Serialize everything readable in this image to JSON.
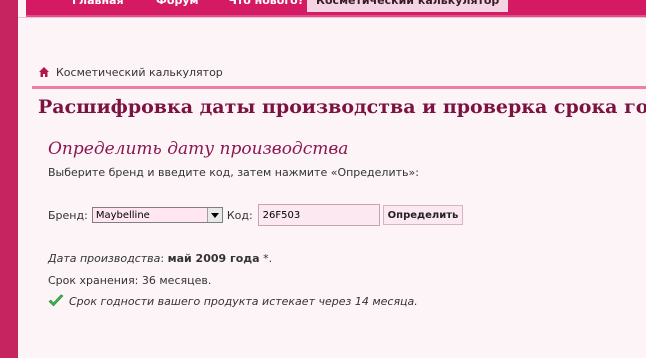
{
  "nav": {
    "items": [
      {
        "label": "Главная"
      },
      {
        "label": "Форум"
      },
      {
        "label": "Что нового?"
      },
      {
        "label": "Косметический калькулятор"
      }
    ]
  },
  "breadcrumb": {
    "label": "Косметический калькулятор"
  },
  "page_title": "Расшифровка даты производства и проверка срока годн",
  "section": {
    "title": "Определить дату производства",
    "instructions": "Выберите бренд и введите код, затем нажмите «Определить»:"
  },
  "form": {
    "brand_label": "Бренд:",
    "brand_value": "Maybelline",
    "code_label": "Код:",
    "code_value": "26F503",
    "submit_label": "Определить"
  },
  "result": {
    "production_label": "Дата производства",
    "production_sep": ": ",
    "production_value": "май 2009 года",
    "production_suffix": " *.",
    "shelf_life": "Срок хранения: 36 месяцев.",
    "expiry_message": "Срок годности вашего продукта истекает через 14 месяца."
  },
  "colors": {
    "nav_bg": "#d41a63",
    "left_bar": "#c52461",
    "page_bg": "#fdf4f8",
    "title": "#7c1240",
    "divider": "#ec7fa8",
    "check": "#3bb54a"
  },
  "icons": {
    "home": "home-icon",
    "check": "check-icon",
    "dropdown": "chevron-down-icon"
  }
}
